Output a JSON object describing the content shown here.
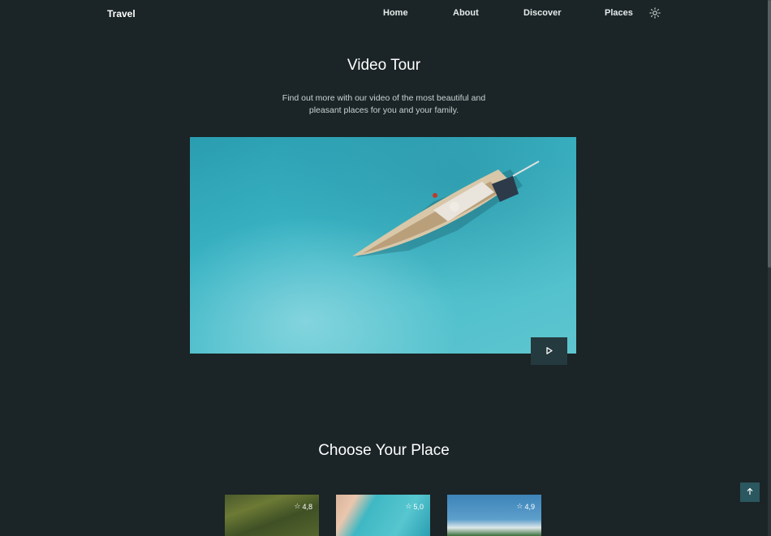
{
  "nav": {
    "logo": "Travel",
    "links": [
      "Home",
      "About",
      "Discover",
      "Places"
    ],
    "theme_icon": "sun-icon"
  },
  "video_section": {
    "title": "Video Tour",
    "description": "Find out more with our video of the most beautiful and pleasant places for you and your family.",
    "play_icon": "play-icon"
  },
  "places_section": {
    "title": "Choose Your Place",
    "cards": [
      {
        "rating": "4,8"
      },
      {
        "rating": "5,0"
      },
      {
        "rating": "4,9"
      }
    ]
  },
  "colors": {
    "background": "#1b2426",
    "button": "#243a3e",
    "scroll_top": "#2b5760"
  }
}
